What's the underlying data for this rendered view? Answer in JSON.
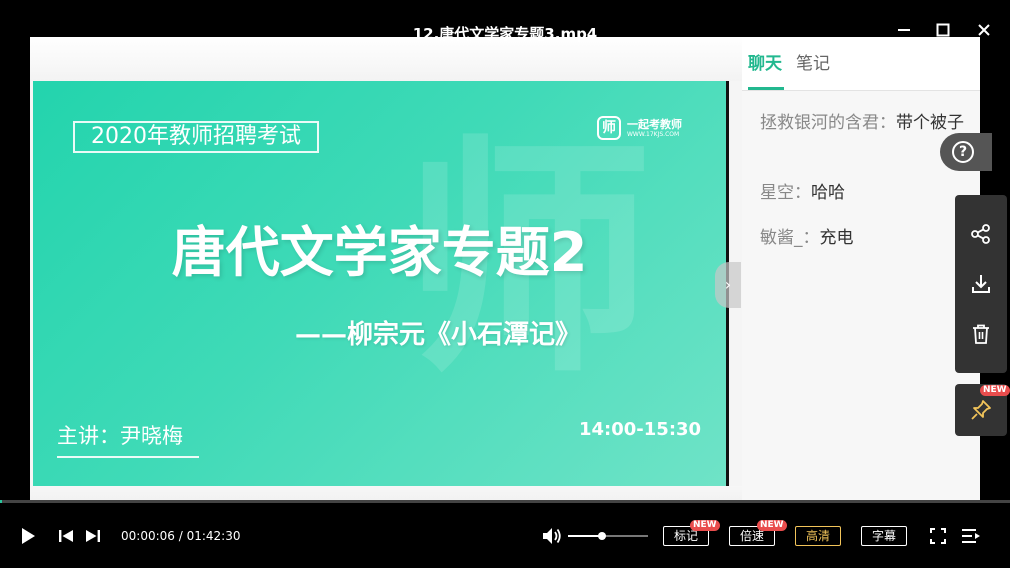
{
  "window": {
    "title": "12.唐代文学家专题3.mp4",
    "minimize_icon": "minimize-icon",
    "maximize_icon": "maximize-icon",
    "close_icon": "close-icon"
  },
  "slide": {
    "exam_label": "2020年教师招聘考试",
    "logo_mark": "师",
    "logo_name": "一起考教师",
    "logo_url": "WWW.17KJS.COM",
    "watermark": "师",
    "main_title": "唐代文学家专题2",
    "sub_title": "——柳宗元《小石潭记》",
    "speaker": "主讲：尹晓梅",
    "time": "14:00-15:30"
  },
  "chat": {
    "tabs": [
      {
        "label": "聊天",
        "active": true
      },
      {
        "label": "笔记",
        "active": false
      }
    ],
    "messages": [
      {
        "user": "拯救银河的含君：",
        "text": "带个被子"
      },
      {
        "user": "星空：",
        "text": "哈哈"
      },
      {
        "user": "敏酱_：",
        "text": "充电"
      }
    ],
    "help_icon": "help-icon"
  },
  "tools": {
    "share_icon": "share-icon",
    "download_icon": "download-icon",
    "delete_icon": "delete-icon",
    "pin_icon": "pin-icon",
    "pin_badge": "NEW"
  },
  "player": {
    "current_time": "00:00:06",
    "total_time": "01:42:30",
    "time_display": "00:00:06 / 01:42:30",
    "progress_fraction": 0.001,
    "volume_fraction": 0.42,
    "buttons": {
      "mark": {
        "label": "标记",
        "badge": "NEW"
      },
      "speed": {
        "label": "倍速",
        "badge": "NEW"
      },
      "quality": {
        "label": "高清"
      },
      "subtitle": {
        "label": "字幕"
      }
    },
    "colors": {
      "accent": "#2ac39c",
      "quality": "#f2c45a",
      "badge": "#e94d4d"
    }
  }
}
